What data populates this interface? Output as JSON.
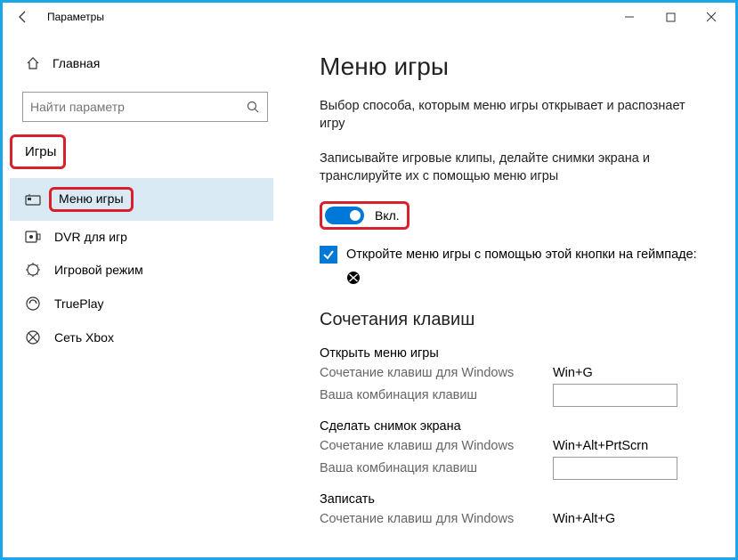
{
  "window": {
    "title": "Параметры"
  },
  "sidebar": {
    "home": "Главная",
    "searchPlaceholder": "Найти параметр",
    "section": "Игры",
    "items": [
      {
        "label": "Меню игры"
      },
      {
        "label": "DVR для игр"
      },
      {
        "label": "Игровой режим"
      },
      {
        "label": "TruePlay"
      },
      {
        "label": "Сеть Xbox"
      }
    ]
  },
  "main": {
    "heading": "Меню игры",
    "desc1": "Выбор способа, которым меню игры открывает и распознает игру",
    "desc2": "Записывайте игровые клипы, делайте снимки экрана и транслируйте их с помощью меню игры",
    "toggleLabel": "Вкл.",
    "checkboxLabel": "Откройте меню игры с помощью этой кнопки на геймпаде:",
    "hotkeysHeading": "Сочетания клавиш",
    "hotkeys": [
      {
        "title": "Открыть меню игры",
        "winLabel": "Сочетание клавиш для Windows",
        "winValue": "Win+G",
        "customLabel": "Ваша комбинация клавиш",
        "customValue": ""
      },
      {
        "title": "Сделать снимок экрана",
        "winLabel": "Сочетание клавиш для Windows",
        "winValue": "Win+Alt+PrtScrn",
        "customLabel": "Ваша комбинация клавиш",
        "customValue": ""
      },
      {
        "title": "Записать",
        "winLabel": "Сочетание клавиш для Windows",
        "winValue": "Win+Alt+G"
      }
    ]
  }
}
